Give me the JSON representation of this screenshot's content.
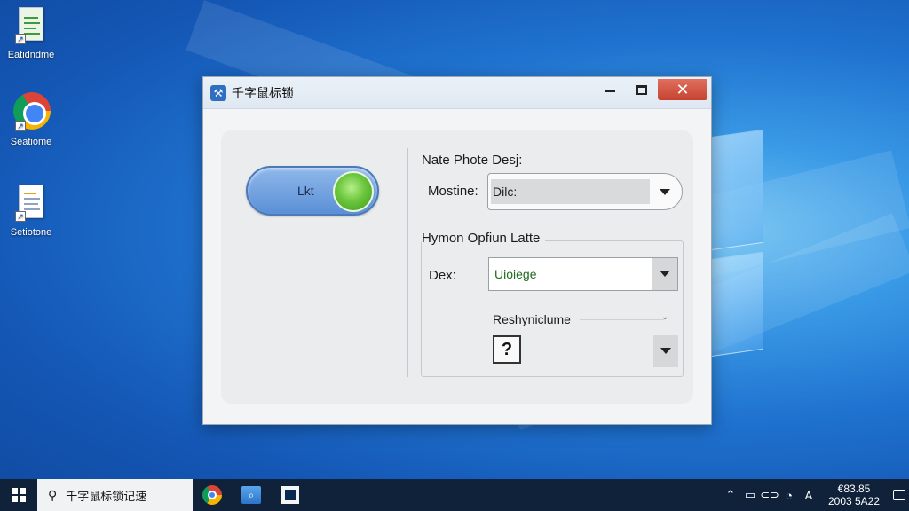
{
  "desktop": {
    "icons": [
      {
        "label": "Eatidndme",
        "icon": "spreadsheet-icon"
      },
      {
        "label": "Seatiome",
        "icon": "chrome-icon"
      },
      {
        "label": "Setiotone",
        "icon": "document-icon"
      }
    ]
  },
  "window": {
    "title": "千字鼠标锁",
    "controls": {
      "minimize": "minimize",
      "maximize": "maximize",
      "close": "✕"
    },
    "toggle": {
      "label": "Lkt",
      "state": "on"
    },
    "top_section": {
      "heading": "Nate Phote Desj:",
      "field_label": "Mostine:",
      "field_value": "Dilc:"
    },
    "group": {
      "legend": "Hymon Opfiun Latte",
      "dex_label": "Dex:",
      "dex_value": "Uioiege",
      "sub_label": "Reshyniclume",
      "help_glyph": "?"
    }
  },
  "taskbar": {
    "search_text": "千字鼠标锁记速",
    "tray": {
      "time": "€83.85",
      "date": "2003 5A22"
    }
  },
  "colors": {
    "toggle_on": "#6bc63c",
    "close_button": "#c8412f",
    "taskbar": "#10213a",
    "dex_text": "#1f6b1f"
  }
}
